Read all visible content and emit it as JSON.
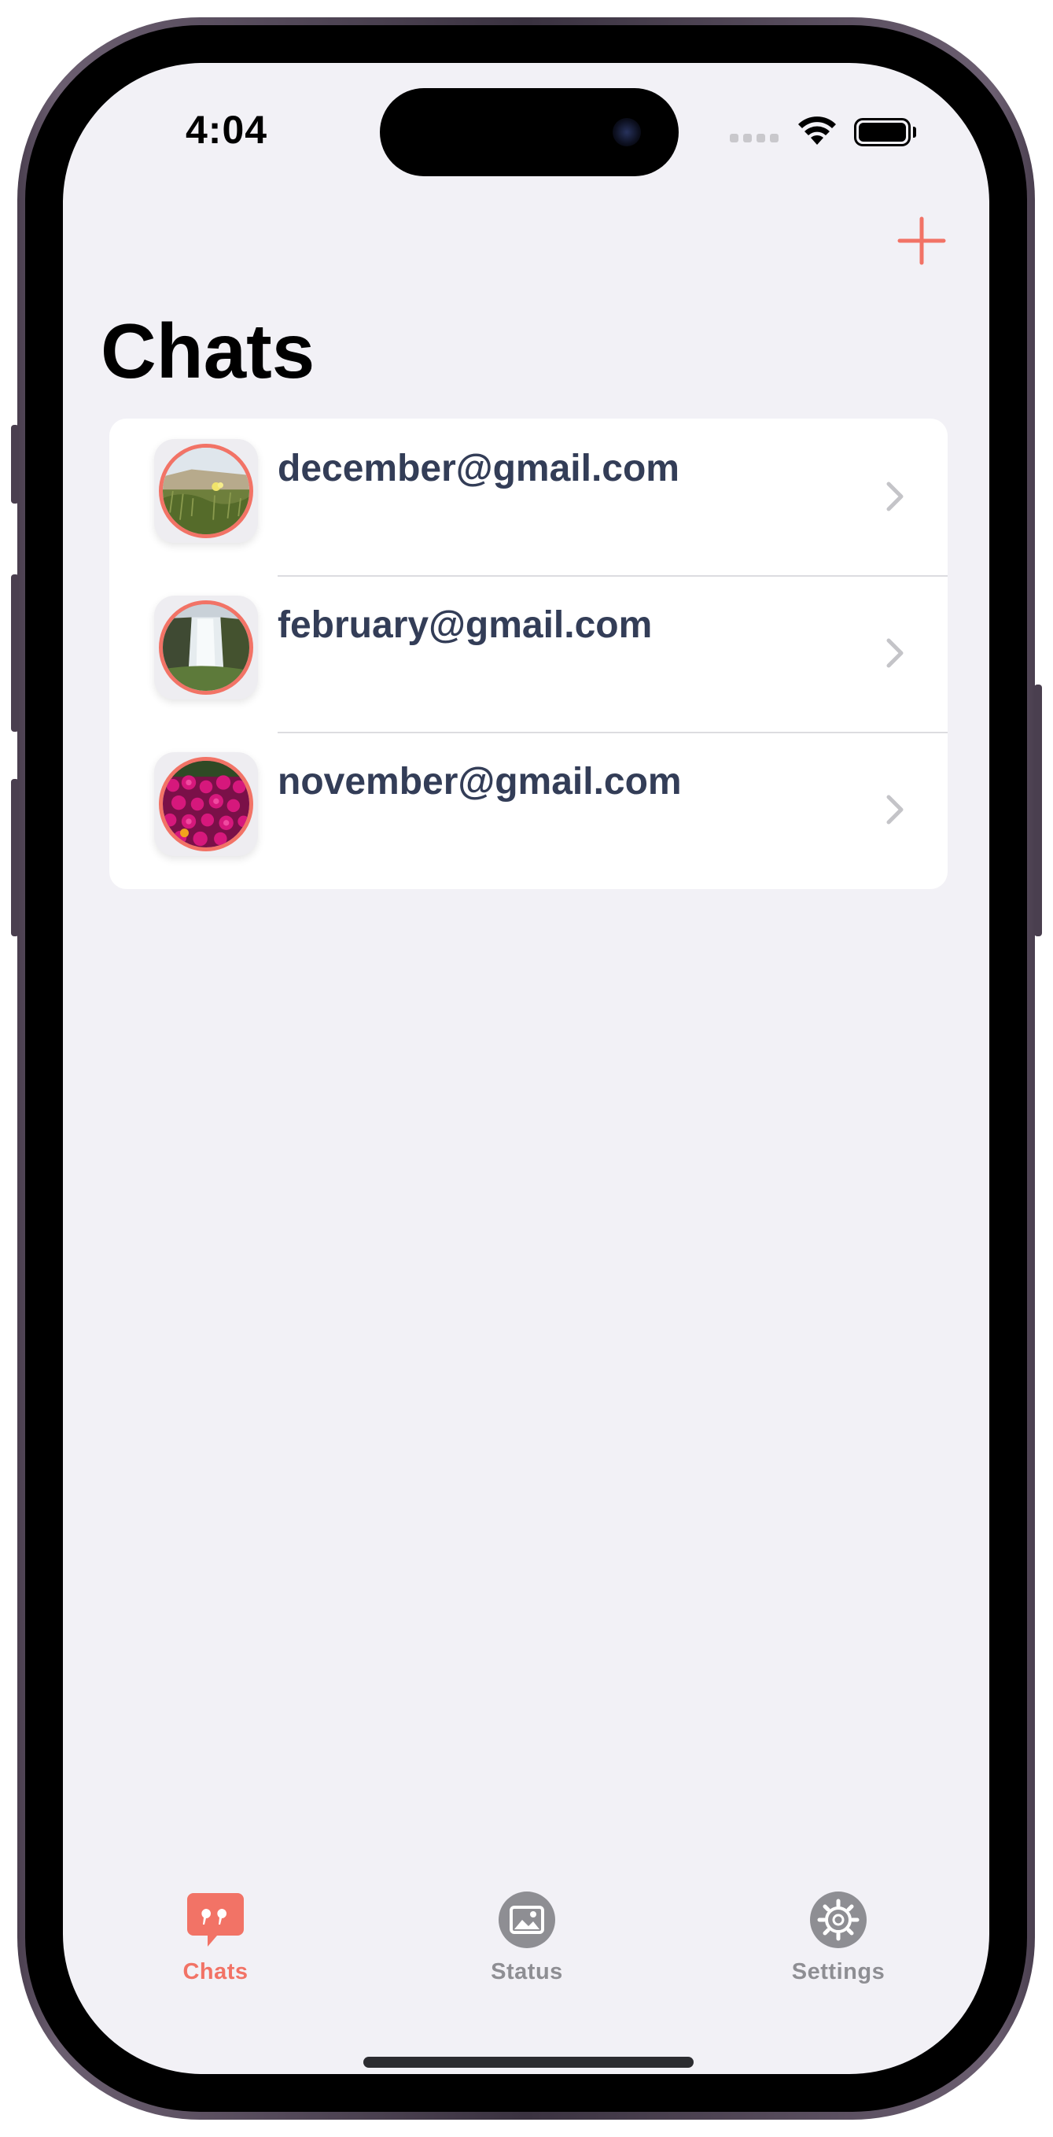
{
  "status_bar": {
    "time": "4:04",
    "battery_level": 1.0
  },
  "header": {
    "title": "Chats",
    "add_icon": "plus-icon"
  },
  "chats": [
    {
      "label": "december@gmail.com",
      "avatar": "grassland-photo"
    },
    {
      "label": "february@gmail.com",
      "avatar": "waterfall-photo"
    },
    {
      "label": "november@gmail.com",
      "avatar": "pink-flowers-photo"
    }
  ],
  "tabbar": {
    "tabs": [
      {
        "label": "Chats",
        "icon": "quote-bubble-icon",
        "active": true
      },
      {
        "label": "Status",
        "icon": "photo-icon",
        "active": false
      },
      {
        "label": "Settings",
        "icon": "gear-icon",
        "active": false
      }
    ]
  },
  "colors": {
    "accent": "#f27366",
    "background": "#f2f1f6",
    "row_text": "#333d57",
    "inactive_tab": "#8e8e93"
  }
}
